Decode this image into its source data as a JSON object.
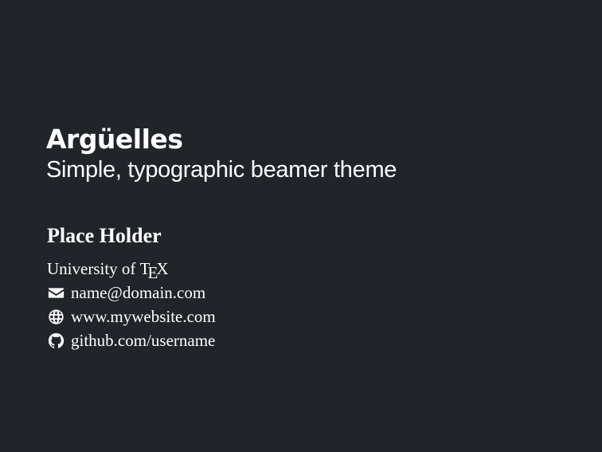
{
  "title": "Argüelles",
  "subtitle": "Simple, typographic beamer theme",
  "author": "Place Holder",
  "institution": {
    "prefix": "University of ",
    "tex_t": "T",
    "tex_e": "E",
    "tex_x": "X"
  },
  "contacts": [
    {
      "icon": "envelope-icon",
      "text": "name@domain.com"
    },
    {
      "icon": "globe-icon",
      "text": "www.mywebsite.com"
    },
    {
      "icon": "github-icon",
      "text": "github.com/username"
    }
  ],
  "colors": {
    "background": "#212429",
    "text": "#ffffff"
  }
}
